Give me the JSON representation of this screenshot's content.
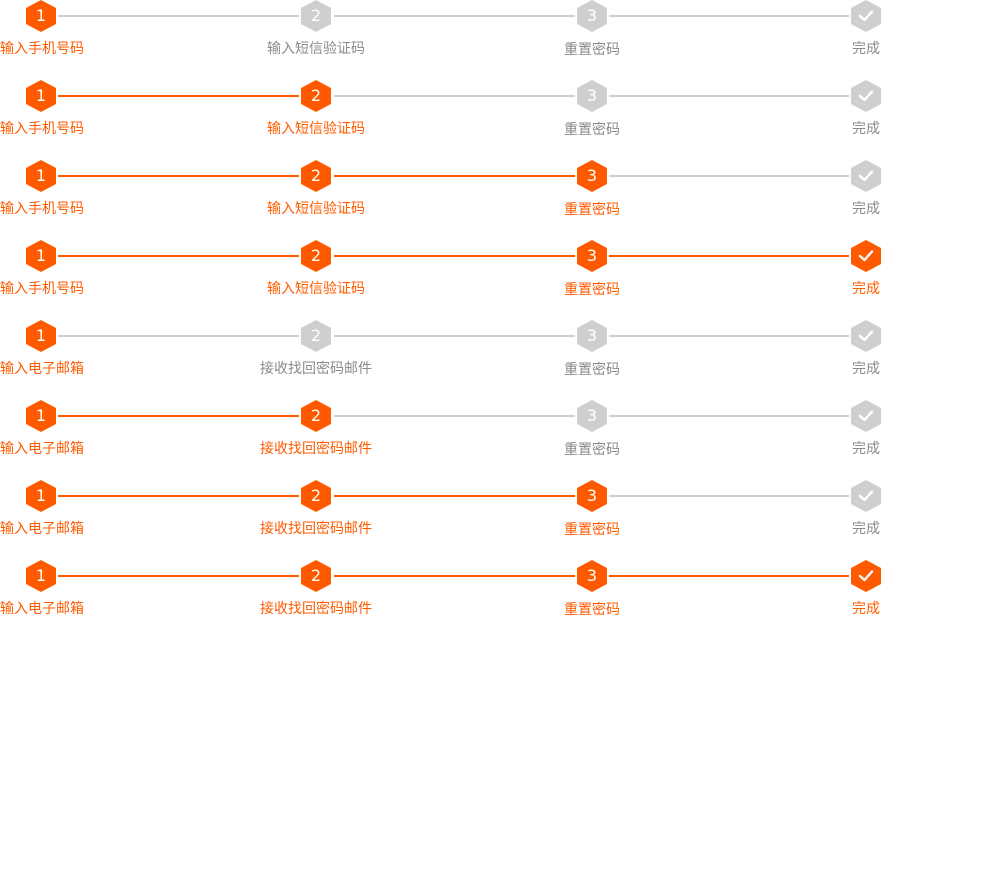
{
  "colors": {
    "active": "#ff5a00",
    "inactive": "#cfcfcf",
    "label_inactive": "#8a8a8a",
    "background": "#ffffff"
  },
  "flows": {
    "phone": {
      "steps": [
        {
          "number": "1",
          "label": "输入手机号码",
          "icon": "step-1"
        },
        {
          "number": "2",
          "label": "输入短信验证码",
          "icon": "step-2"
        },
        {
          "number": "3",
          "label": "重置密码",
          "icon": "step-3"
        },
        {
          "number": "",
          "label": "完成",
          "icon": "check-icon"
        }
      ]
    },
    "email": {
      "steps": [
        {
          "number": "1",
          "label": "输入电子邮箱",
          "icon": "step-1"
        },
        {
          "number": "2",
          "label": "接收找回密码邮件",
          "icon": "step-2"
        },
        {
          "number": "3",
          "label": "重置密码",
          "icon": "step-3"
        },
        {
          "number": "",
          "label": "完成",
          "icon": "check-icon"
        }
      ]
    }
  },
  "steppers": [
    {
      "flow": "phone",
      "completed_steps": 1
    },
    {
      "flow": "phone",
      "completed_steps": 2
    },
    {
      "flow": "phone",
      "completed_steps": 3
    },
    {
      "flow": "phone",
      "completed_steps": 4
    },
    {
      "flow": "email",
      "completed_steps": 1
    },
    {
      "flow": "email",
      "completed_steps": 2
    },
    {
      "flow": "email",
      "completed_steps": 3
    },
    {
      "flow": "email",
      "completed_steps": 4
    }
  ]
}
